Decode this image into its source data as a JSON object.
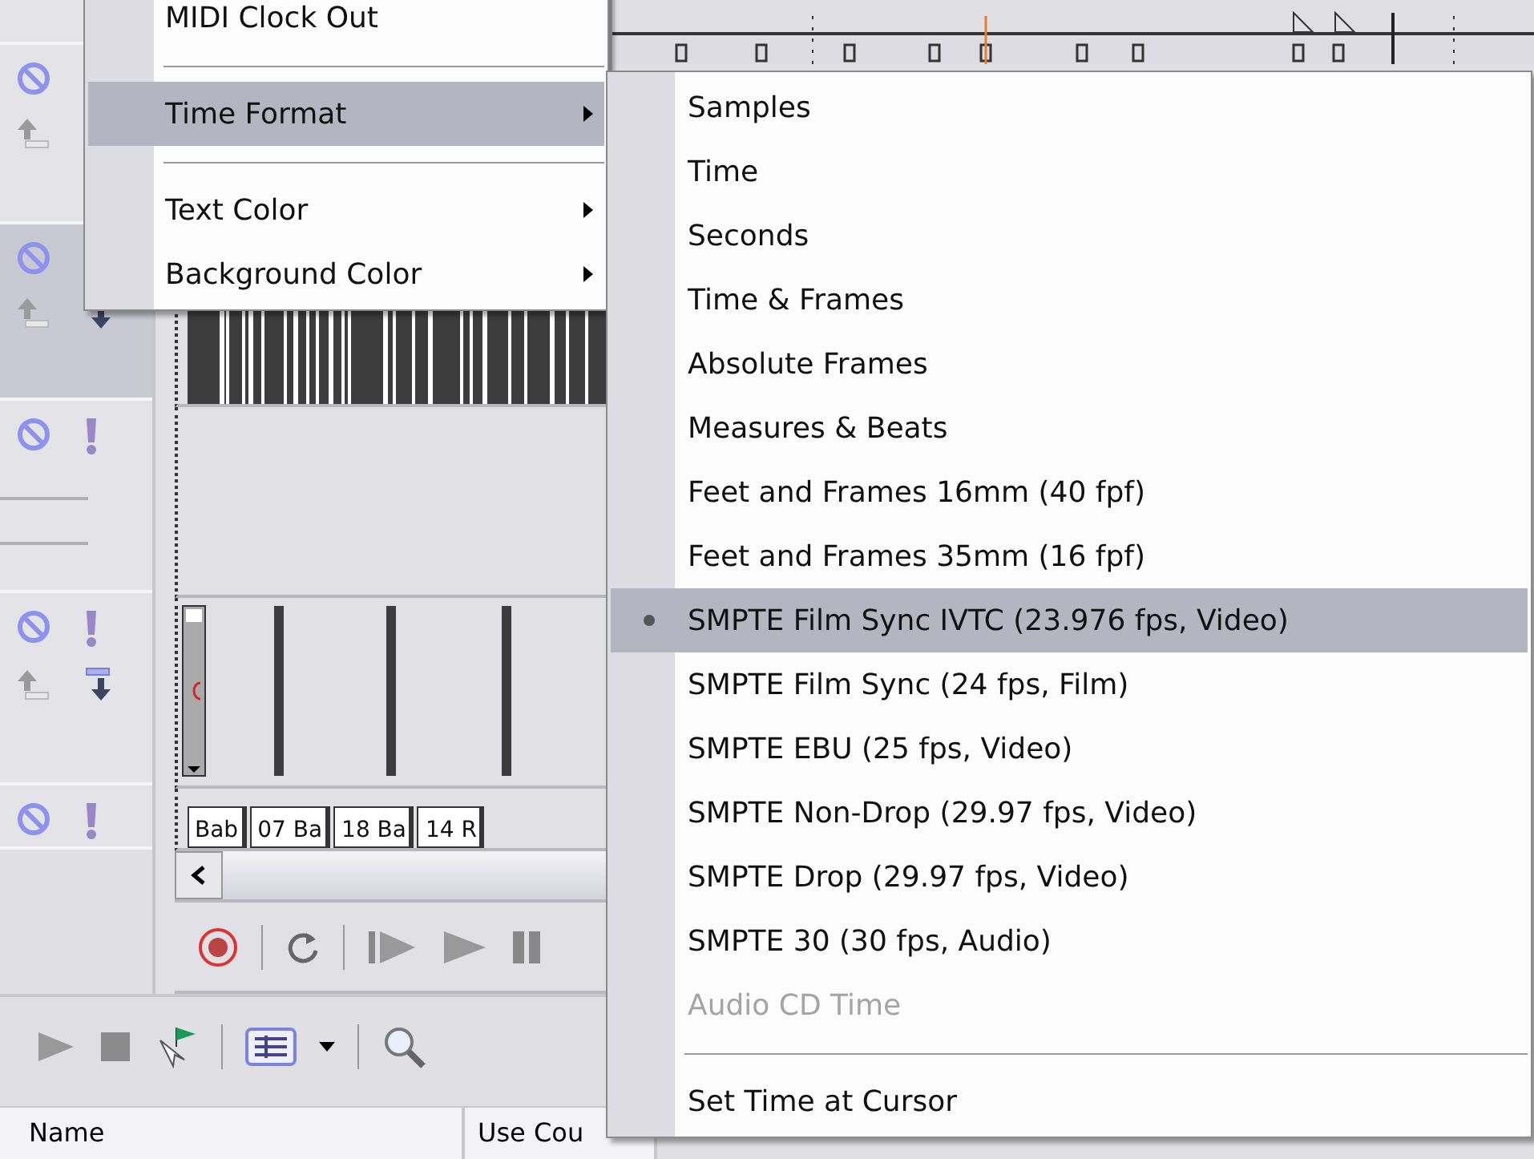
{
  "tracks": [
    {
      "selected": false
    },
    {
      "selected": true
    },
    {
      "selected": false
    },
    {
      "selected": false
    },
    {
      "selected": false
    }
  ],
  "clips": [
    "Bab",
    "07 Ba",
    "18 Ba",
    "14 R"
  ],
  "table": {
    "columns": [
      "Name",
      "Use Cou"
    ]
  },
  "context_menu": {
    "items": [
      {
        "kind": "item",
        "label": "MIDI Clock Out",
        "submenu": false,
        "selected": false
      },
      {
        "kind": "separator"
      },
      {
        "kind": "item",
        "label": "Time Format",
        "submenu": true,
        "selected": true
      },
      {
        "kind": "separator"
      },
      {
        "kind": "item",
        "label": "Text Color",
        "submenu": true,
        "selected": false
      },
      {
        "kind": "item",
        "label": "Background Color",
        "submenu": true,
        "selected": false
      }
    ]
  },
  "submenu": {
    "items": [
      {
        "kind": "item",
        "label": "Samples",
        "checked": false,
        "selected": false,
        "disabled": false
      },
      {
        "kind": "item",
        "label": "Time",
        "checked": false,
        "selected": false,
        "disabled": false
      },
      {
        "kind": "item",
        "label": "Seconds",
        "checked": false,
        "selected": false,
        "disabled": false
      },
      {
        "kind": "item",
        "label": "Time & Frames",
        "checked": false,
        "selected": false,
        "disabled": false
      },
      {
        "kind": "item",
        "label": "Absolute Frames",
        "checked": false,
        "selected": false,
        "disabled": false
      },
      {
        "kind": "item",
        "label": "Measures & Beats",
        "checked": false,
        "selected": false,
        "disabled": false
      },
      {
        "kind": "item",
        "label": "Feet and Frames 16mm (40 fpf)",
        "checked": false,
        "selected": false,
        "disabled": false
      },
      {
        "kind": "item",
        "label": "Feet and Frames 35mm (16 fpf)",
        "checked": false,
        "selected": false,
        "disabled": false
      },
      {
        "kind": "item",
        "label": "SMPTE Film Sync IVTC (23.976 fps, Video)",
        "checked": true,
        "selected": true,
        "disabled": false
      },
      {
        "kind": "item",
        "label": "SMPTE Film Sync (24 fps, Film)",
        "checked": false,
        "selected": false,
        "disabled": false
      },
      {
        "kind": "item",
        "label": "SMPTE EBU (25 fps, Video)",
        "checked": false,
        "selected": false,
        "disabled": false
      },
      {
        "kind": "item",
        "label": "SMPTE Non-Drop (29.97 fps, Video)",
        "checked": false,
        "selected": false,
        "disabled": false
      },
      {
        "kind": "item",
        "label": "SMPTE Drop (29.97 fps, Video)",
        "checked": false,
        "selected": false,
        "disabled": false
      },
      {
        "kind": "item",
        "label": "SMPTE 30 (30 fps, Audio)",
        "checked": false,
        "selected": false,
        "disabled": false
      },
      {
        "kind": "item",
        "label": "Audio CD Time",
        "checked": false,
        "selected": false,
        "disabled": true
      },
      {
        "kind": "separator"
      },
      {
        "kind": "item",
        "label": "Set Time at Cursor",
        "checked": false,
        "selected": false,
        "disabled": false
      }
    ]
  }
}
